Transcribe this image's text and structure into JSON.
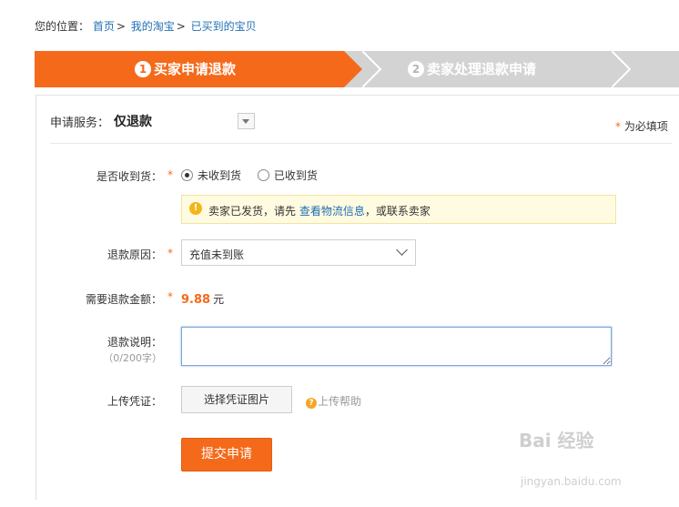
{
  "breadcrumb": {
    "prefix": "您的位置：",
    "items": [
      "首页",
      "我的淘宝",
      "已买到的宝贝"
    ],
    "separator": ">"
  },
  "steps": [
    {
      "number": "1",
      "label": "买家申请退款",
      "active": true
    },
    {
      "number": "2",
      "label": "卖家处理退款申请",
      "active": false
    }
  ],
  "colors": {
    "accent": "#f56a1a",
    "inactive_step": "#d3d3d3",
    "link": "#1f6fb5"
  },
  "service": {
    "label": "申请服务：",
    "value": "仅退款"
  },
  "required_note": {
    "star": "*",
    "text": "为必填项"
  },
  "form": {
    "received": {
      "label": "是否收到货：",
      "options": [
        {
          "label": "未收到货",
          "checked": true
        },
        {
          "label": "已收到货",
          "checked": false
        }
      ]
    },
    "notice": {
      "icon": "info-icon",
      "before": "卖家已发货，请先 ",
      "link": "查看物流信息",
      "after": "，或联系卖家"
    },
    "reason": {
      "label": "退款原因：",
      "value": "充值未到账"
    },
    "amount": {
      "label": "需要退款金额：",
      "value": "9.88",
      "unit": "元"
    },
    "description": {
      "label": "退款说明：",
      "hint": "（0/200字）",
      "value": ""
    },
    "voucher": {
      "label": "上传凭证：",
      "button": "选择凭证图片",
      "help": "上传帮助"
    },
    "submit": "提交申请"
  },
  "watermark": {
    "brand": "Bai 经验",
    "url": "jingyan.baidu.com"
  }
}
